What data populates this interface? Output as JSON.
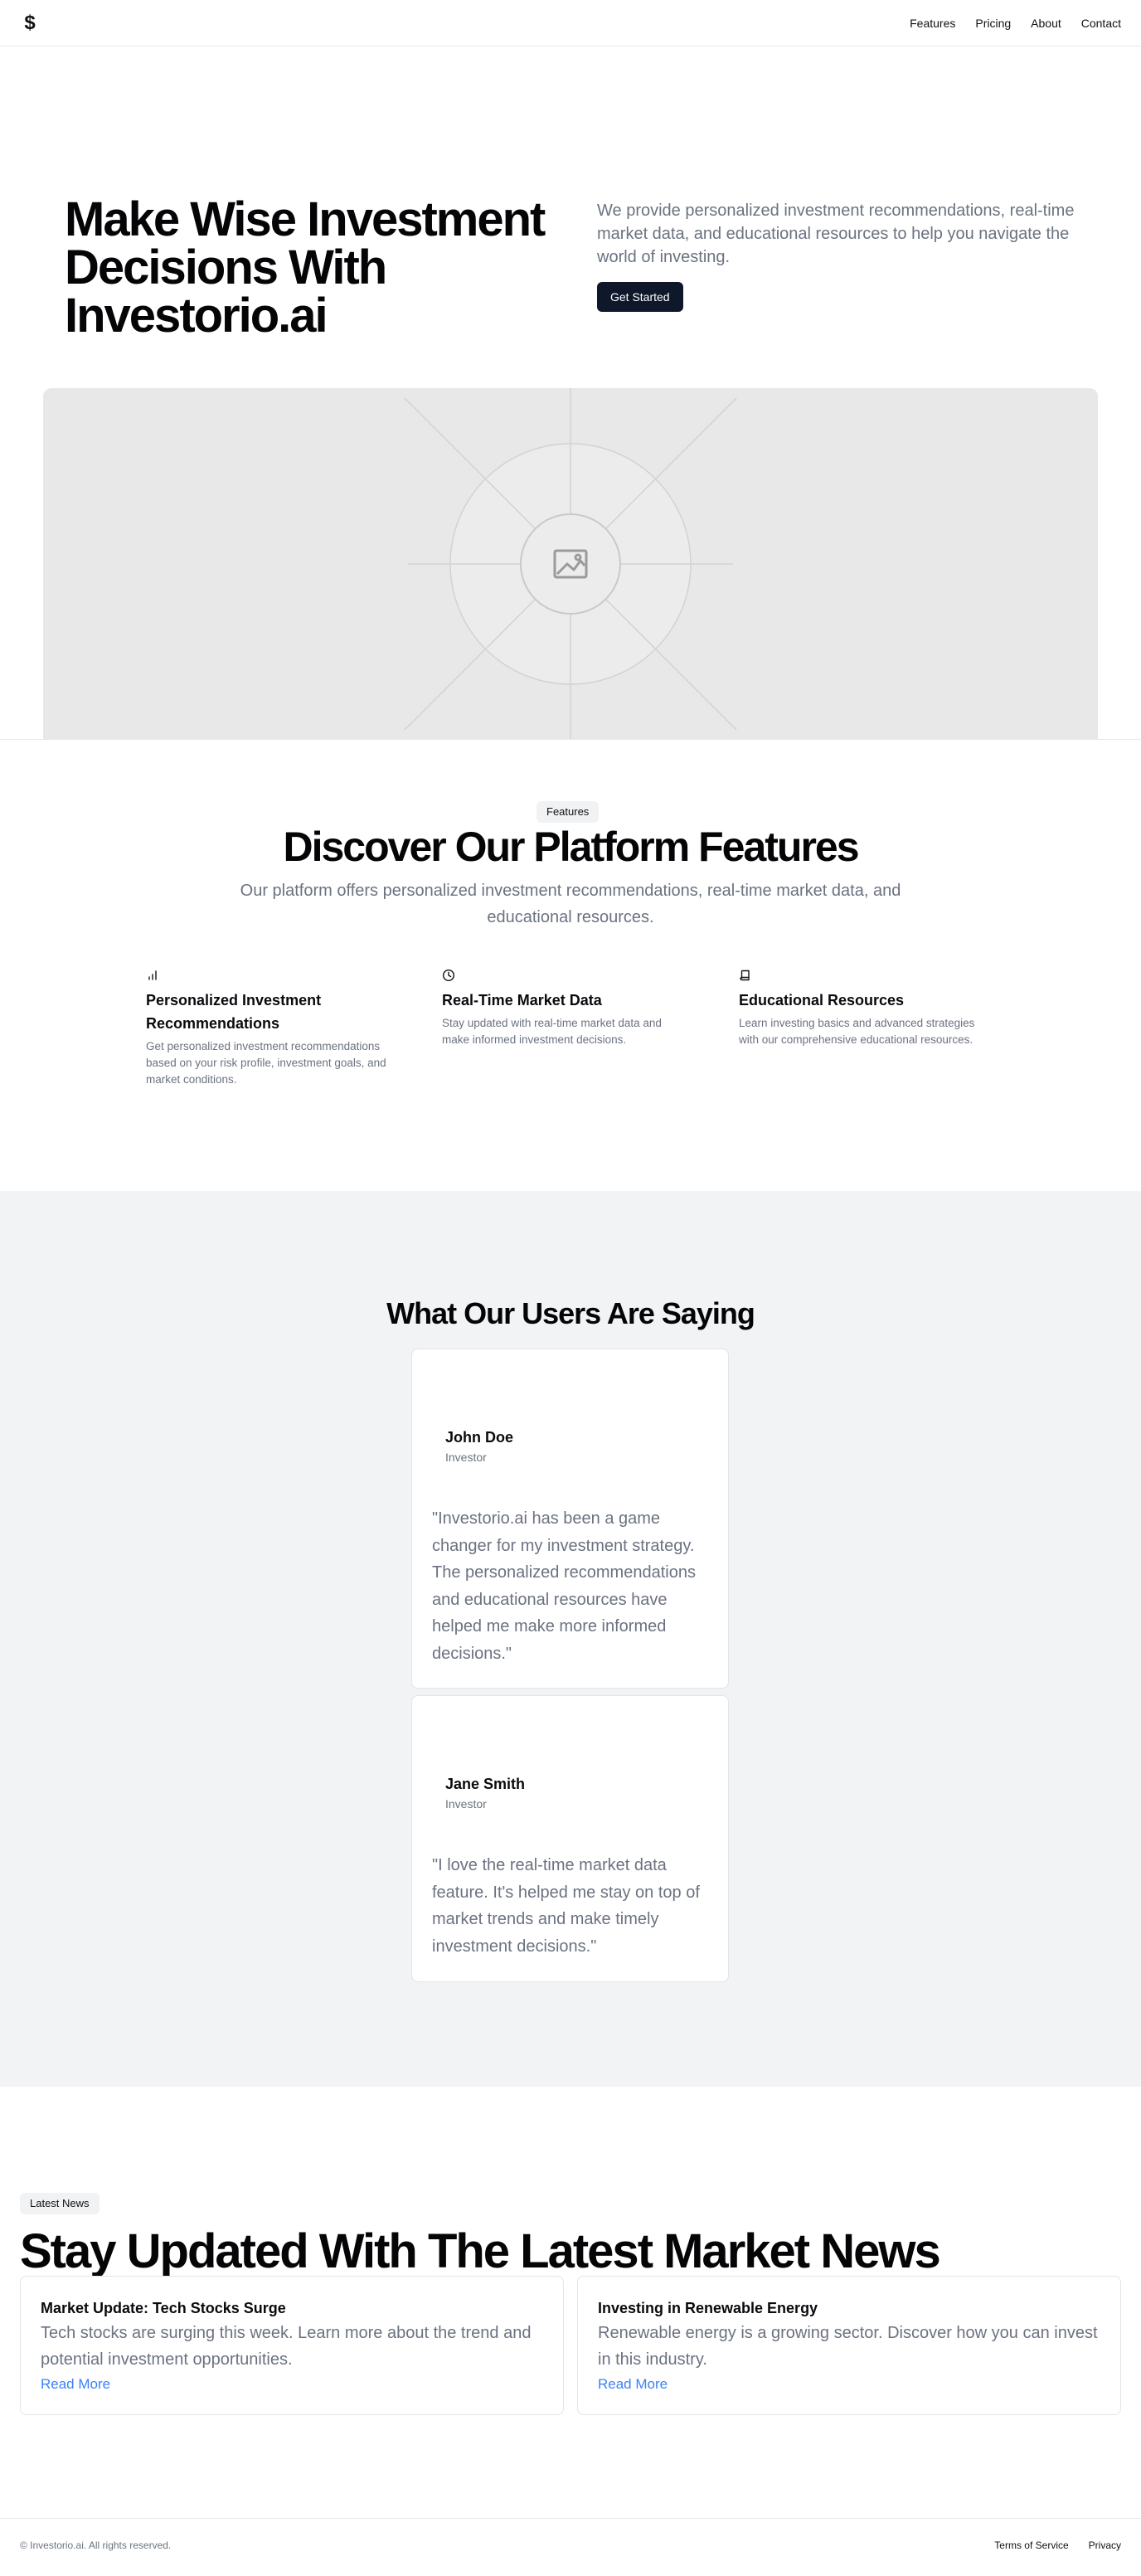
{
  "header": {
    "logo_symbol": "$",
    "nav": [
      "Features",
      "Pricing",
      "About",
      "Contact"
    ]
  },
  "hero": {
    "title": "Make Wise Investment Decisions With Investorio.ai",
    "description": "We provide personalized investment recommendations, real-time market data, and educational resources to help you navigate the world of investing.",
    "cta_label": "Get Started",
    "image_icon": "image-placeholder-icon"
  },
  "features": {
    "badge": "Features",
    "title": "Discover Our Platform Features",
    "subtitle": "Our platform offers personalized investment recommendations, real-time market data, and educational resources.",
    "items": [
      {
        "icon": "bar-chart-icon",
        "title": "Personalized Investment Recommendations",
        "description": "Get personalized investment recommendations based on your risk profile, investment goals, and market conditions."
      },
      {
        "icon": "clock-icon",
        "title": "Real-Time Market Data",
        "description": "Stay updated with real-time market data and make informed investment decisions."
      },
      {
        "icon": "book-icon",
        "title": "Educational Resources",
        "description": "Learn investing basics and advanced strategies with our comprehensive educational resources."
      }
    ]
  },
  "testimonials": {
    "title": "What Our Users Are Saying",
    "items": [
      {
        "name": "John Doe",
        "role": "Investor",
        "quote": "\"Investorio.ai has been a game changer for my investment strategy. The personalized recommendations and educational resources have helped me make more informed decisions.\""
      },
      {
        "name": "Jane Smith",
        "role": "Investor",
        "quote": "\"I love the real-time market data feature. It's helped me stay on top of market trends and make timely investment decisions.\""
      }
    ]
  },
  "news": {
    "badge": "Latest News",
    "title": "Stay Updated With The Latest Market News",
    "items": [
      {
        "title": "Market Update: Tech Stocks Surge",
        "description": "Tech stocks are surging this week. Learn more about the trend and potential investment opportunities.",
        "link": "Read More"
      },
      {
        "title": "Investing in Renewable Energy",
        "description": "Renewable energy is a growing sector. Discover how you can invest in this industry.",
        "link": "Read More"
      }
    ]
  },
  "footer": {
    "copyright": "© Investorio.ai. All rights reserved.",
    "links": [
      "Terms of Service",
      "Privacy"
    ]
  },
  "colors": {
    "primary_button": "#0f172a",
    "link": "#3b82f6",
    "muted_text": "#6b7280",
    "section_gray": "#f2f3f5"
  }
}
